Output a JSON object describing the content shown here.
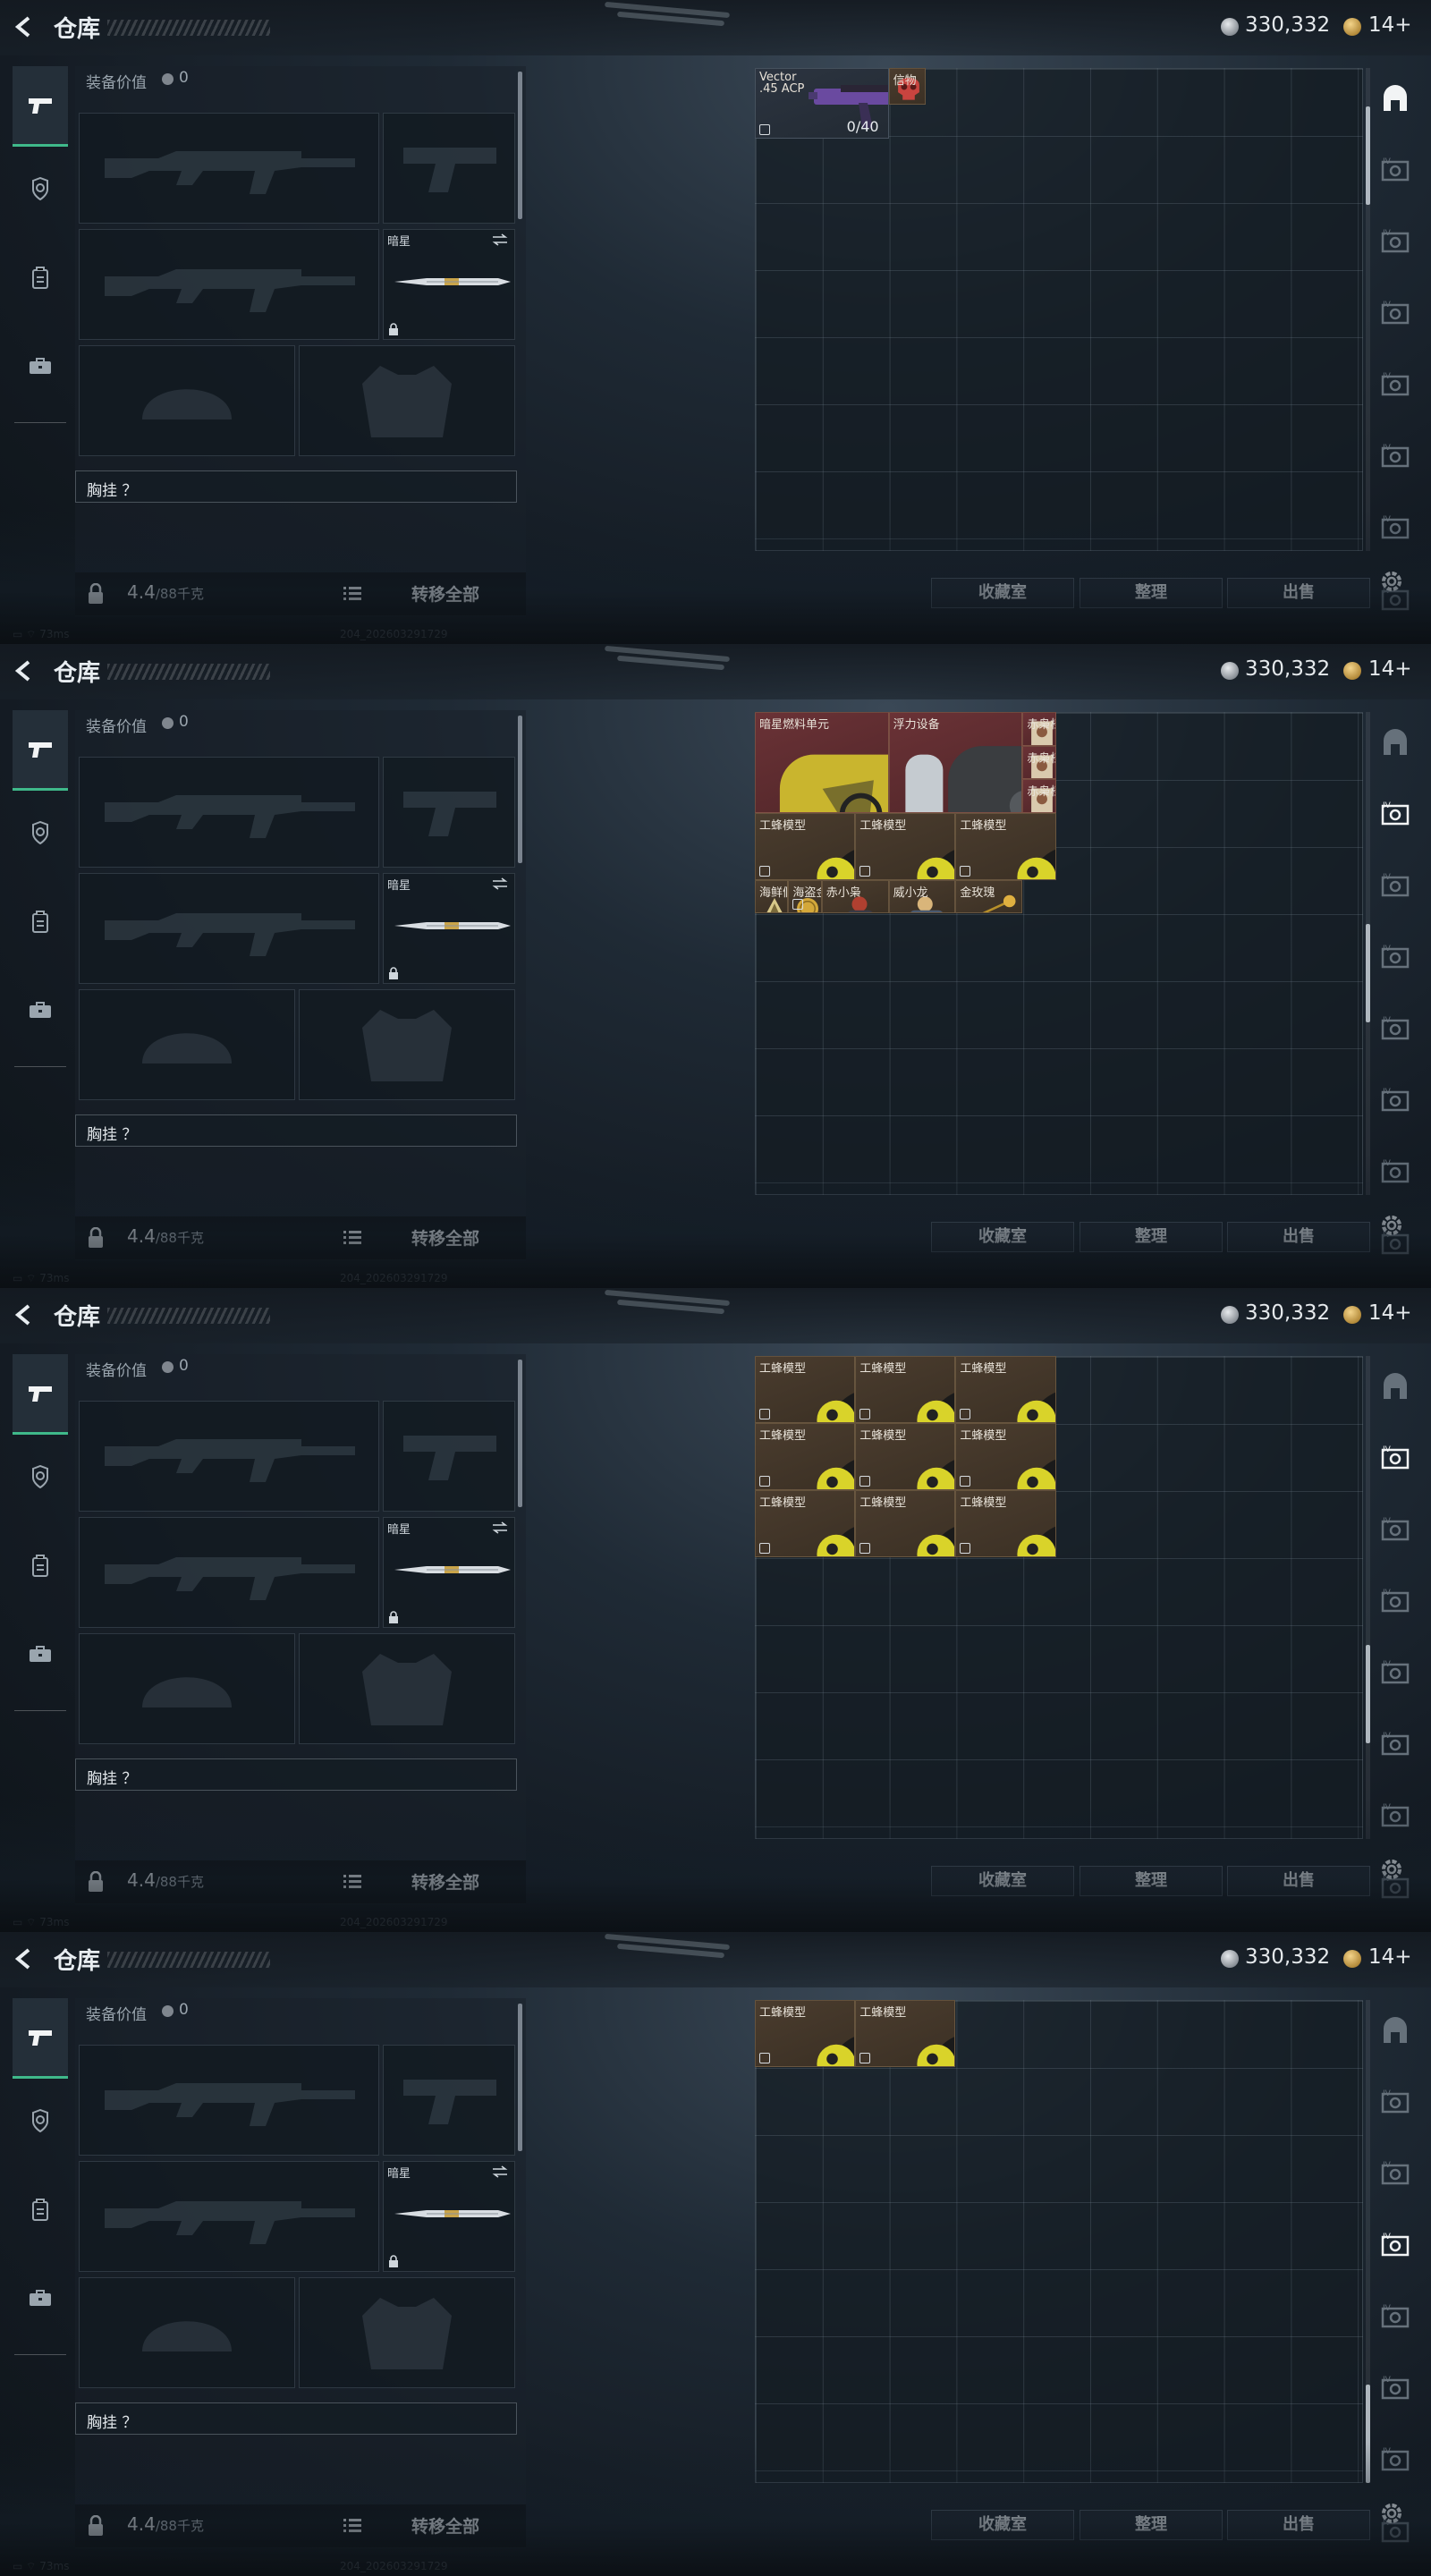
{
  "title": "仓库",
  "currency": {
    "silver": "330,332",
    "gold": "14+"
  },
  "equipment": {
    "value_label": "装备价值",
    "value": "0",
    "melee_label": "暗星",
    "chest_label": "胸挂 ？",
    "weight_value": "4.4",
    "weight_unit": "/88千克",
    "transfer_all": "转移全部"
  },
  "actions": {
    "collection": "收藏室",
    "arrange": "整理",
    "sell": "出售"
  },
  "status": {
    "ping": "73ms",
    "build": "204_202603291729"
  },
  "icons": {
    "back": "back-arrow-icon",
    "left_tabs": [
      "pistol-icon",
      "helmet-icon",
      "backpack-icon",
      "briefcase-icon"
    ],
    "right_tabs": [
      "safe-icon",
      "container-icon",
      "container-icon",
      "container-icon",
      "container-icon",
      "container-icon",
      "container-icon",
      "container-icon"
    ],
    "settings": "gear-icon"
  },
  "colors": {
    "active_tab": "#3fb98a",
    "item_brown": "#4a3c2e",
    "item_red": "#6a3236"
  },
  "screens": [
    {
      "active_right_tab": 0,
      "scroll_position": 0.1,
      "items": [
        {
          "name": "Vector",
          "sub": ".45 ACP",
          "ammo": "0/40",
          "kind": "gun"
        },
        {
          "name": "信物",
          "kind": "skull"
        }
      ]
    },
    {
      "active_right_tab": 1,
      "scroll_position": 0.55,
      "items": [
        {
          "name": "暗星燃料单元",
          "kind": "fuel"
        },
        {
          "name": "浮力设备",
          "kind": "scuba"
        },
        {
          "name": "赤枭档案",
          "kind": "file"
        },
        {
          "name": "赤枭档案",
          "kind": "file"
        },
        {
          "name": "赤枭档案",
          "kind": "file"
        },
        {
          "name": "工蜂模型",
          "kind": "bee"
        },
        {
          "name": "工蜂模型",
          "kind": "bee"
        },
        {
          "name": "工蜂模型",
          "kind": "bee"
        },
        {
          "name": "海鲜假罐头",
          "kind": "pyramid"
        },
        {
          "name": "海盗金币",
          "kind": "coin"
        },
        {
          "name": "赤小枭",
          "kind": "doll"
        },
        {
          "name": "威小龙",
          "kind": "doll2"
        },
        {
          "name": "金玫瑰",
          "kind": "rose"
        }
      ]
    },
    {
      "active_right_tab": 1,
      "scroll_position": 0.75,
      "items": [
        {
          "name": "工蜂模型",
          "kind": "bee"
        },
        {
          "name": "工蜂模型",
          "kind": "bee"
        },
        {
          "name": "工蜂模型",
          "kind": "bee"
        },
        {
          "name": "工蜂模型",
          "kind": "bee"
        },
        {
          "name": "工蜂模型",
          "kind": "bee"
        },
        {
          "name": "工蜂模型",
          "kind": "bee"
        },
        {
          "name": "工蜂模型",
          "kind": "bee"
        },
        {
          "name": "工蜂模型",
          "kind": "bee"
        },
        {
          "name": "工蜂模型",
          "kind": "bee"
        }
      ]
    },
    {
      "active_right_tab": 3,
      "scroll_position": 1.0,
      "items": [
        {
          "name": "工蜂模型",
          "kind": "bee"
        },
        {
          "name": "工蜂模型",
          "kind": "bee"
        }
      ]
    }
  ]
}
